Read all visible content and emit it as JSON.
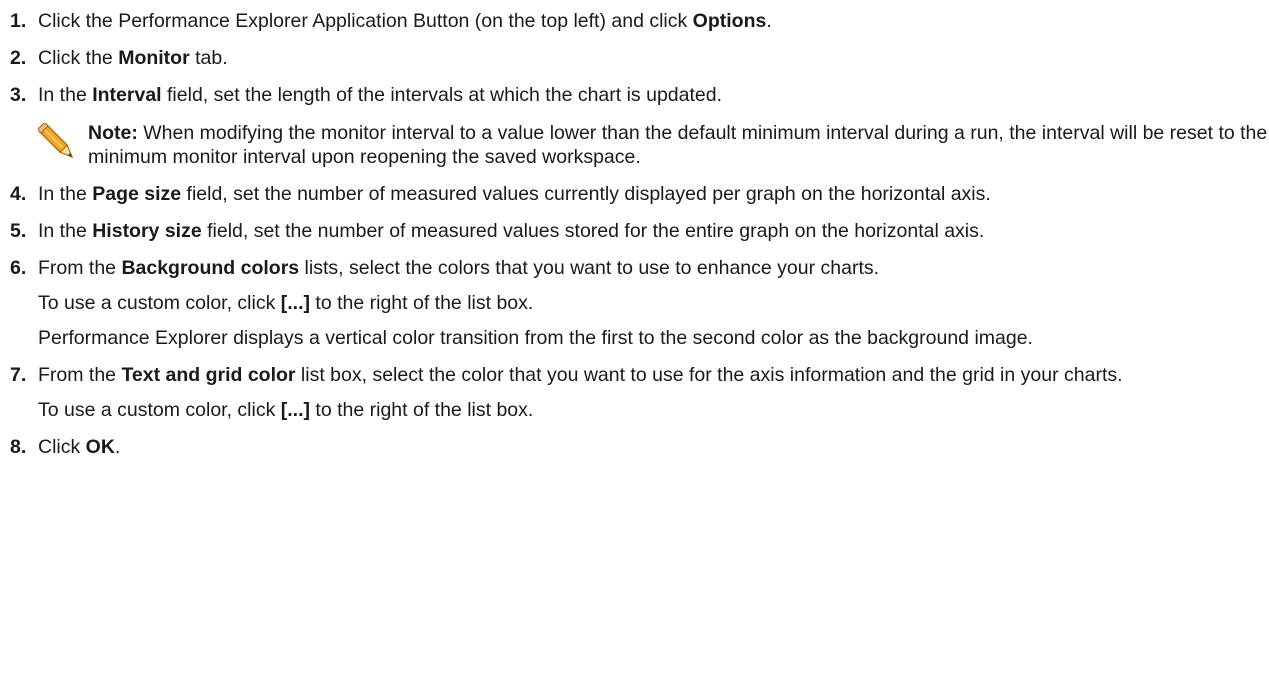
{
  "steps": [
    {
      "num": "1.",
      "before": "Click the Performance Explorer Application Button (on the top left) and click ",
      "bold": "Options",
      "after": "."
    },
    {
      "num": "2.",
      "before": "Click the ",
      "bold": "Monitor",
      "after": " tab."
    },
    {
      "num": "3.",
      "before": "In the ",
      "bold": "Interval",
      "after": " field, set the length of the intervals at which the chart is updated.",
      "note": {
        "icon": "pencil-icon",
        "label": "Note:",
        "text": " When modifying the monitor interval to a value lower than the default minimum interval during a run, the interval will be reset to the minimum monitor interval upon reopening the saved workspace."
      }
    },
    {
      "num": "4.",
      "before": "In the ",
      "bold": "Page size",
      "after": " field, set the number of measured values currently displayed per graph on the horizontal axis."
    },
    {
      "num": "5.",
      "before": "In the ",
      "bold": "History size",
      "after": " field, set the number of measured values stored for the entire graph on the horizontal axis."
    },
    {
      "num": "6.",
      "before": "From the ",
      "bold": "Background colors",
      "after": " lists, select the colors that you want to use to enhance your charts.",
      "info1": {
        "before": "To use a custom color, click ",
        "bold": "[...]",
        "after": " to the right of the list box."
      },
      "info2": "Performance Explorer displays a vertical color transition from the first to the second color as the background image."
    },
    {
      "num": "7.",
      "before": "From the ",
      "bold": "Text and grid color",
      "after": " list box, select the color that you want to use for the axis information and the grid in your charts.",
      "info1": {
        "before": "To use a custom color, click ",
        "bold": "[...]",
        "after": " to the right of the list box."
      }
    },
    {
      "num": "8.",
      "before": "Click ",
      "bold": "OK",
      "after": "."
    }
  ],
  "colors": {
    "text": "#1a1a1a",
    "pencil_body": "#f5a623",
    "pencil_outline": "#b86b00"
  }
}
